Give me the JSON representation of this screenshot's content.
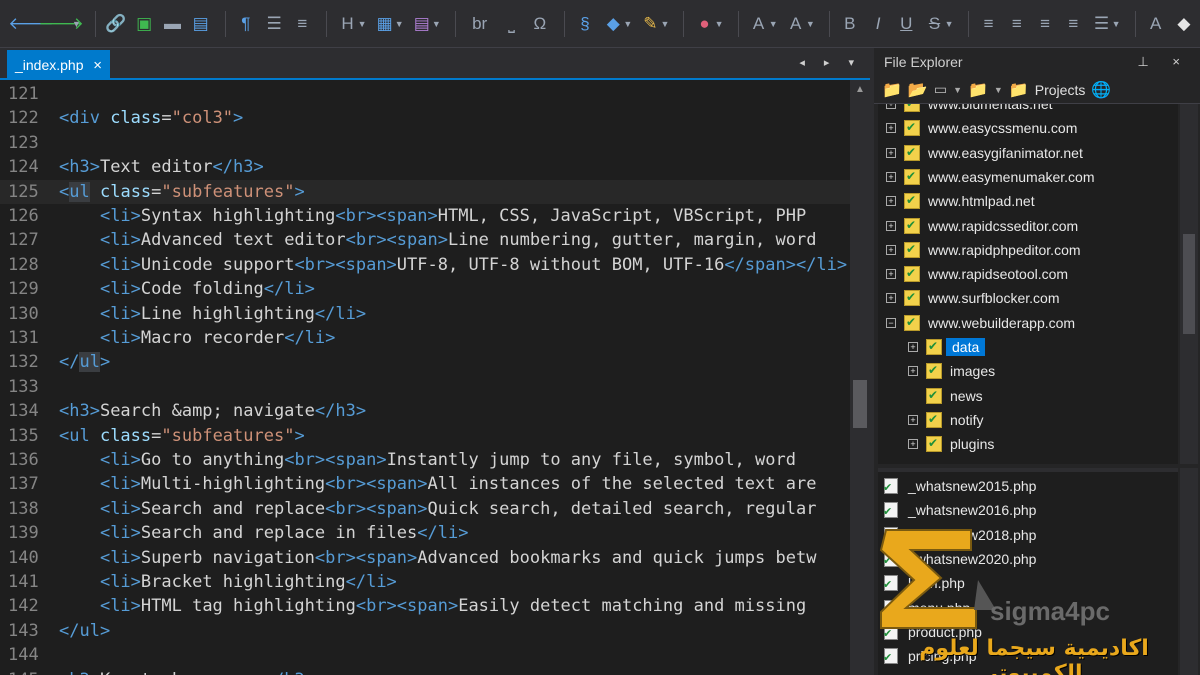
{
  "editor": {
    "tab_label": "_index.php",
    "tab_close": "×",
    "tab_nav": "◂ ▸ ▾",
    "lines": [
      {
        "n": "121",
        "segs": []
      },
      {
        "n": "122",
        "segs": [
          [
            "tag",
            "<div "
          ],
          [
            "attr",
            "class"
          ],
          [
            "plain",
            "="
          ],
          [
            "str",
            "\"col3\""
          ],
          [
            "tag",
            ">"
          ]
        ]
      },
      {
        "n": "123",
        "segs": []
      },
      {
        "n": "124",
        "segs": [
          [
            "tag",
            "<h3>"
          ],
          [
            "plain",
            "Text editor"
          ],
          [
            "tag",
            "</h3>"
          ]
        ]
      },
      {
        "n": "125",
        "cur": true,
        "segs": [
          [
            "tag",
            "<"
          ],
          [
            "tag hlb",
            "ul"
          ],
          [
            "plain",
            " "
          ],
          [
            "attr",
            "class"
          ],
          [
            "plain",
            "="
          ],
          [
            "str",
            "\"subfeatures\""
          ],
          [
            "tag",
            ">"
          ]
        ]
      },
      {
        "n": "126",
        "segs": [
          [
            "plain",
            "    "
          ],
          [
            "tag",
            "<li>"
          ],
          [
            "plain",
            "Syntax highlighting"
          ],
          [
            "tag",
            "<br><span>"
          ],
          [
            "plain",
            "HTML, CSS, JavaScript, VBScript, PHP"
          ]
        ]
      },
      {
        "n": "127",
        "segs": [
          [
            "plain",
            "    "
          ],
          [
            "tag",
            "<li>"
          ],
          [
            "plain",
            "Advanced text editor"
          ],
          [
            "tag",
            "<br><span>"
          ],
          [
            "plain",
            "Line numbering, gutter, margin, word"
          ]
        ]
      },
      {
        "n": "128",
        "segs": [
          [
            "plain",
            "    "
          ],
          [
            "tag",
            "<li>"
          ],
          [
            "plain",
            "Unicode support"
          ],
          [
            "tag",
            "<br><span>"
          ],
          [
            "plain",
            "UTF-8, UTF-8 without BOM, UTF-16"
          ],
          [
            "tag",
            "</span></li>"
          ]
        ]
      },
      {
        "n": "129",
        "segs": [
          [
            "plain",
            "    "
          ],
          [
            "tag",
            "<li>"
          ],
          [
            "plain",
            "Code folding"
          ],
          [
            "tag",
            "</li>"
          ]
        ]
      },
      {
        "n": "130",
        "segs": [
          [
            "plain",
            "    "
          ],
          [
            "tag",
            "<li>"
          ],
          [
            "plain",
            "Line highlighting"
          ],
          [
            "tag",
            "</li>"
          ]
        ]
      },
      {
        "n": "131",
        "segs": [
          [
            "plain",
            "    "
          ],
          [
            "tag",
            "<li>"
          ],
          [
            "plain",
            "Macro recorder"
          ],
          [
            "tag",
            "</li>"
          ]
        ]
      },
      {
        "n": "132",
        "segs": [
          [
            "tag",
            "</"
          ],
          [
            "tag hlb",
            "ul"
          ],
          [
            "tag",
            ">"
          ]
        ]
      },
      {
        "n": "133",
        "segs": []
      },
      {
        "n": "134",
        "segs": [
          [
            "tag",
            "<h3>"
          ],
          [
            "plain",
            "Search &amp; navigate"
          ],
          [
            "tag",
            "</h3>"
          ]
        ]
      },
      {
        "n": "135",
        "segs": [
          [
            "tag",
            "<ul "
          ],
          [
            "attr",
            "class"
          ],
          [
            "plain",
            "="
          ],
          [
            "str",
            "\"subfeatures\""
          ],
          [
            "tag",
            ">"
          ]
        ]
      },
      {
        "n": "136",
        "segs": [
          [
            "plain",
            "    "
          ],
          [
            "tag",
            "<li>"
          ],
          [
            "plain",
            "Go to anything"
          ],
          [
            "tag",
            "<br><span>"
          ],
          [
            "plain",
            "Instantly jump to any file, symbol, word"
          ]
        ]
      },
      {
        "n": "137",
        "segs": [
          [
            "plain",
            "    "
          ],
          [
            "tag",
            "<li>"
          ],
          [
            "plain",
            "Multi-highlighting"
          ],
          [
            "tag",
            "<br><span>"
          ],
          [
            "plain",
            "All instances of the selected text are"
          ]
        ]
      },
      {
        "n": "138",
        "segs": [
          [
            "plain",
            "    "
          ],
          [
            "tag",
            "<li>"
          ],
          [
            "plain",
            "Search and replace"
          ],
          [
            "tag",
            "<br><span>"
          ],
          [
            "plain",
            "Quick search, detailed search, regular"
          ]
        ]
      },
      {
        "n": "139",
        "segs": [
          [
            "plain",
            "    "
          ],
          [
            "tag",
            "<li>"
          ],
          [
            "plain",
            "Search and replace in files"
          ],
          [
            "tag",
            "</li>"
          ]
        ]
      },
      {
        "n": "140",
        "segs": [
          [
            "plain",
            "    "
          ],
          [
            "tag",
            "<li>"
          ],
          [
            "plain",
            "Superb navigation"
          ],
          [
            "tag",
            "<br><span>"
          ],
          [
            "plain",
            "Advanced bookmarks and quick jumps betw"
          ]
        ]
      },
      {
        "n": "141",
        "segs": [
          [
            "plain",
            "    "
          ],
          [
            "tag",
            "<li>"
          ],
          [
            "plain",
            "Bracket highlighting"
          ],
          [
            "tag",
            "</li>"
          ]
        ]
      },
      {
        "n": "142",
        "segs": [
          [
            "plain",
            "    "
          ],
          [
            "tag",
            "<li>"
          ],
          [
            "plain",
            "HTML tag highlighting"
          ],
          [
            "tag",
            "<br><span>"
          ],
          [
            "plain",
            "Easily detect matching and missing"
          ]
        ]
      },
      {
        "n": "143",
        "segs": [
          [
            "tag",
            "</ul>"
          ]
        ]
      },
      {
        "n": "144",
        "segs": []
      },
      {
        "n": "145",
        "segs": [
          [
            "tag",
            "<h3>"
          ],
          [
            "plain",
            "Keystroke savers"
          ],
          [
            "tag",
            "</h3>"
          ]
        ]
      }
    ]
  },
  "explorer": {
    "title": "File Explorer",
    "pin": "⊥ ×",
    "projects_label": "Projects",
    "tree": [
      {
        "label": "www.blumentals.net",
        "pm": "+",
        "indent": 0
      },
      {
        "label": "www.easycssmenu.com",
        "pm": "+",
        "indent": 0
      },
      {
        "label": "www.easygifanimator.net",
        "pm": "+",
        "indent": 0
      },
      {
        "label": "www.easymenumaker.com",
        "pm": "+",
        "indent": 0
      },
      {
        "label": "www.htmlpad.net",
        "pm": "+",
        "indent": 0
      },
      {
        "label": "www.rapidcsseditor.com",
        "pm": "+",
        "indent": 0
      },
      {
        "label": "www.rapidphpeditor.com",
        "pm": "+",
        "indent": 0
      },
      {
        "label": "www.rapidseotool.com",
        "pm": "+",
        "indent": 0
      },
      {
        "label": "www.surfblocker.com",
        "pm": "+",
        "indent": 0
      },
      {
        "label": "www.webuilderapp.com",
        "pm": "−",
        "indent": 0
      },
      {
        "label": "data",
        "pm": "+",
        "indent": 1,
        "selected": true
      },
      {
        "label": "images",
        "pm": "+",
        "indent": 1
      },
      {
        "label": "news",
        "pm": "",
        "indent": 1
      },
      {
        "label": "notify",
        "pm": "+",
        "indent": 1
      },
      {
        "label": "plugins",
        "pm": "+",
        "indent": 1
      }
    ],
    "files": [
      "_whatsnew2015.php",
      "_whatsnew2016.php",
      "_whatsnew2018.php",
      "_whatsnew2020.php",
      "login.php",
      "menu.php",
      "product.php",
      "pricing.php"
    ]
  },
  "watermark": {
    "brand": "sigma4pc",
    "arabic": "اكاديمية سيجما لعلوم الكمبيوتر",
    "color": "#e9a81c"
  }
}
